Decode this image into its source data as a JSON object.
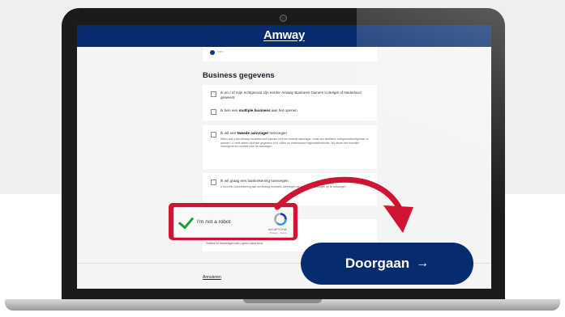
{
  "brand": {
    "logo": "Amway",
    "primary_color": "#062b6e",
    "accent_red": "#cf1434"
  },
  "top_option": {
    "label": "Nee"
  },
  "section": {
    "title": "Business gegevens"
  },
  "options": {
    "a1_label": "Ik en / of mijn echtgenoot zijn eerder Amway Business Owners in België of Nederland geweest.",
    "a2_prefix": "Ik ben een ",
    "a2_bold": "multiple business",
    "a2_suffix": " aan het openen",
    "b_prefix": "Ik wil een ",
    "b_bold": "tweede aanvrager",
    "b_suffix": " toevoegen",
    "b_help": "Wist u dat u een Amway business kunt openen met een tweede aanvrager, zoals een familielid, echtgenoot/echtgenote of partner? U heeft alleen zijn/haar gegevens in te vullen op onderstaand registratieformulier. Wij sturen het formulier vervolgens ter controle naar de aanvrager.",
    "c_label": "Ik wil graag een bankrekening toevoegen",
    "c_help": "U kunt een bankrekening aan uw Amway business toevoegen om uw bonusbetalingen op te ontvangen"
  },
  "error": {
    "text": "Gelieve te bevestigen dat u geen robot bent."
  },
  "footer": {
    "cancel_label": "Annuleren"
  },
  "captcha": {
    "label": "I'm not a robot",
    "brand": "reCAPTCHA",
    "links": "Privacy - Terms",
    "check_color": "#1f9b3a"
  },
  "cta": {
    "label": "Doorgaan",
    "arrow": "→"
  }
}
